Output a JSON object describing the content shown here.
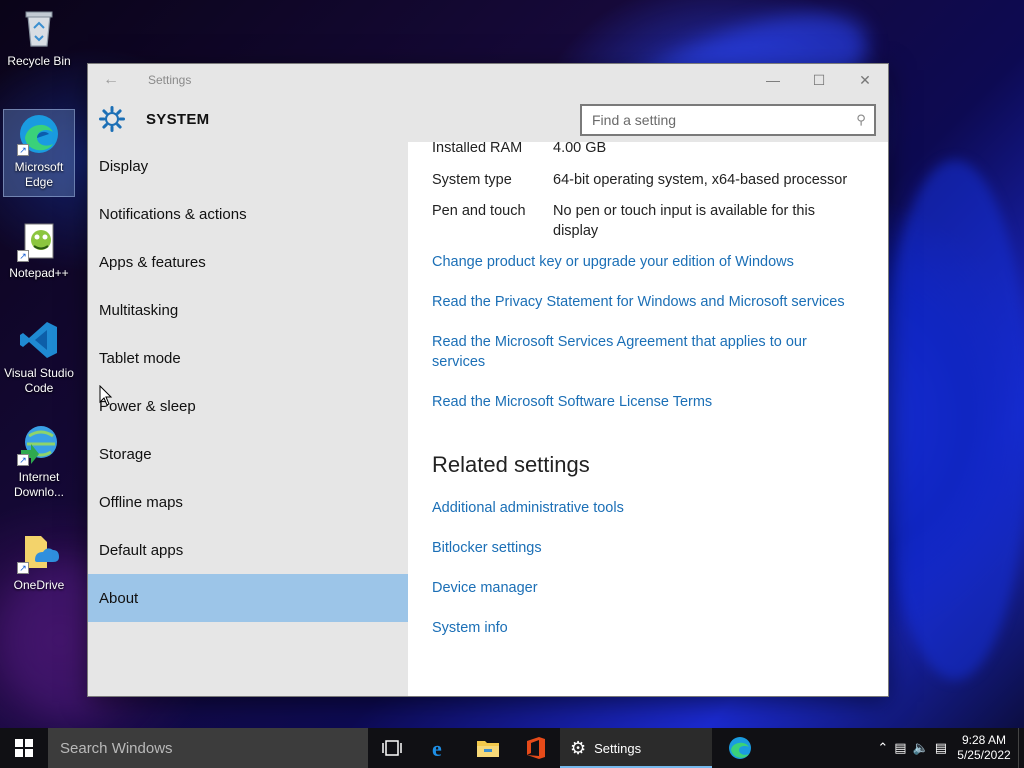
{
  "desktop": {
    "icons": [
      {
        "label": "Recycle Bin"
      },
      {
        "label": "Microsoft Edge"
      },
      {
        "label": "Notepad++"
      },
      {
        "label": "Visual Studio Code"
      },
      {
        "label": "Internet Downlo..."
      },
      {
        "label": "OneDrive"
      }
    ]
  },
  "window": {
    "title": "Settings",
    "back_icon": "back-arrow-icon",
    "controls": {
      "minimize": "minimize-icon",
      "maximize": "maximize-icon",
      "close": "close-icon"
    },
    "header": {
      "title": "SYSTEM",
      "search_placeholder": "Find a setting"
    },
    "sidebar": {
      "items": [
        {
          "label": "Display"
        },
        {
          "label": "Notifications & actions"
        },
        {
          "label": "Apps & features"
        },
        {
          "label": "Multitasking"
        },
        {
          "label": "Tablet mode"
        },
        {
          "label": "Power & sleep"
        },
        {
          "label": "Storage"
        },
        {
          "label": "Offline maps"
        },
        {
          "label": "Default apps"
        },
        {
          "label": "About",
          "active": true
        }
      ]
    },
    "about": {
      "properties": [
        {
          "key": "Installed RAM",
          "value": "4.00 GB"
        },
        {
          "key": "System type",
          "value": "64-bit operating system, x64-based processor"
        },
        {
          "key": "Pen and touch",
          "value": "No pen or touch input is available for this display"
        }
      ],
      "links": [
        "Change product key or upgrade your edition of Windows",
        "Read the Privacy Statement for Windows and Microsoft services",
        "Read the Microsoft Services Agreement that applies to our services",
        "Read the Microsoft Software License Terms"
      ],
      "related_heading": "Related settings",
      "related_links": [
        "Additional administrative tools",
        "Bitlocker settings",
        "Device manager",
        "System info"
      ]
    }
  },
  "taskbar": {
    "search_placeholder": "Search Windows",
    "active_app_label": "Settings",
    "clock": {
      "time": "9:28 AM",
      "date": "5/25/2022"
    }
  },
  "colors": {
    "accent": "#1b6fb6",
    "active_nav": "#9cc5e8",
    "chrome": "#e6e6e6",
    "taskbar": "#101014"
  }
}
